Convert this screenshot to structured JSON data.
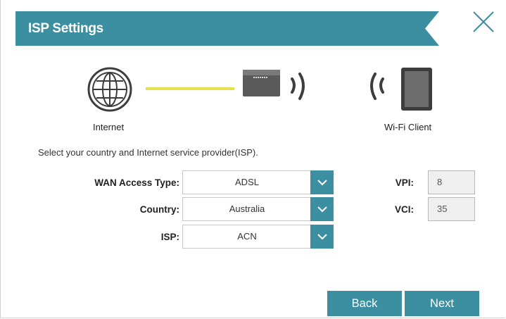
{
  "dialog": {
    "title": "ISP Settings",
    "close_icon": "close-icon"
  },
  "diagram": {
    "internet_label": "Internet",
    "client_label": "Wi-Fi Client",
    "icons": [
      "globe-icon",
      "router-icon",
      "wifi-signal-icon",
      "tablet-icon"
    ]
  },
  "instruction": "Select your country and Internet service provider(ISP).",
  "form": {
    "wan_access_type": {
      "label": "WAN Access Type:",
      "value": "ADSL"
    },
    "country": {
      "label": "Country:",
      "value": "Australia"
    },
    "isp": {
      "label": "ISP:",
      "value": "ACN"
    },
    "vpi": {
      "label": "VPI:",
      "value": "8"
    },
    "vci": {
      "label": "VCI:",
      "value": "35"
    }
  },
  "buttons": {
    "back": "Back",
    "next": "Next"
  },
  "colors": {
    "accent": "#3c8fa0",
    "link_line": "#e8e04a"
  }
}
